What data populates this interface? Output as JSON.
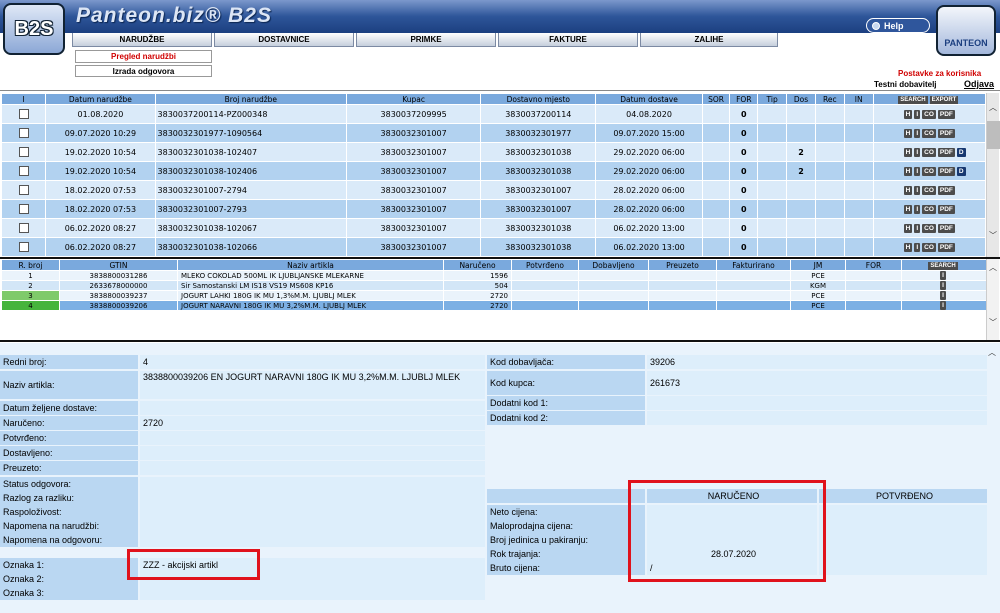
{
  "header": {
    "logo_text": "B2S",
    "brand": "Panteon.biz® B2S",
    "help": "Help",
    "right_logo_text": "PANTEON",
    "tabs": [
      "NARUDŽBE",
      "DOSTAVNICE",
      "PRIMKE",
      "FAKTURE",
      "ZALIHE"
    ],
    "sub_active": "Pregled narudžbi",
    "sub_other": "Izrada odgovora",
    "postavke": "Postavke za korisnika",
    "user": "Testni dobavitelj",
    "logout": "Odjava"
  },
  "orders": {
    "columns": [
      "I",
      "Datum narudžbe",
      "Broj narudžbe",
      "Kupac",
      "Dostavno mjesto",
      "Datum dostave",
      "SOR",
      "FOR",
      "Tip",
      "Dos",
      "Rec",
      "IN"
    ],
    "search": "SEARCH",
    "export": "EXPORT",
    "rows": [
      {
        "date": "01.08.2020",
        "num": "3830037200114-PZ000348",
        "kupac": "3830037209995",
        "mjesto": "3830037200114",
        "dostava": "04.08.2020",
        "for": "0",
        "dos": "",
        "btns": [
          "H",
          "I",
          "CO",
          "PDF"
        ]
      },
      {
        "date": "09.07.2020 10:29",
        "num": "3830032301977-1090564",
        "kupac": "3830032301007",
        "mjesto": "3830032301977",
        "dostava": "09.07.2020 15:00",
        "for": "0",
        "dos": "",
        "btns": [
          "H",
          "I",
          "CO",
          "PDF"
        ]
      },
      {
        "date": "19.02.2020 10:54",
        "num": "3830032301038-102407",
        "kupac": "3830032301007",
        "mjesto": "3830032301038",
        "dostava": "29.02.2020 06:00",
        "for": "0",
        "dos": "2",
        "btns": [
          "H",
          "I",
          "CO",
          "PDF",
          "D"
        ]
      },
      {
        "date": "19.02.2020 10:54",
        "num": "3830032301038-102406",
        "kupac": "3830032301007",
        "mjesto": "3830032301038",
        "dostava": "29.02.2020 06:00",
        "for": "0",
        "dos": "2",
        "btns": [
          "H",
          "I",
          "CO",
          "PDF",
          "D"
        ]
      },
      {
        "date": "18.02.2020 07:53",
        "num": "3830032301007-2794",
        "kupac": "3830032301007",
        "mjesto": "3830032301007",
        "dostava": "28.02.2020 06:00",
        "for": "0",
        "dos": "",
        "btns": [
          "H",
          "I",
          "CO",
          "PDF"
        ]
      },
      {
        "date": "18.02.2020 07:53",
        "num": "3830032301007-2793",
        "kupac": "3830032301007",
        "mjesto": "3830032301007",
        "dostava": "28.02.2020 06:00",
        "for": "0",
        "dos": "",
        "btns": [
          "H",
          "I",
          "CO",
          "PDF"
        ]
      },
      {
        "date": "06.02.2020 08:27",
        "num": "3830032301038-102067",
        "kupac": "3830032301007",
        "mjesto": "3830032301038",
        "dostava": "06.02.2020 13:00",
        "for": "0",
        "dos": "",
        "btns": [
          "H",
          "I",
          "CO",
          "PDF"
        ]
      },
      {
        "date": "06.02.2020 08:27",
        "num": "3830032301038-102066",
        "kupac": "3830032301007",
        "mjesto": "3830032301038",
        "dostava": "06.02.2020 13:00",
        "for": "0",
        "dos": "",
        "btns": [
          "H",
          "I",
          "CO",
          "PDF"
        ]
      }
    ]
  },
  "items": {
    "columns": [
      "R. broj",
      "GTIN",
      "Naziv artikla",
      "Naručeno",
      "Potvrđeno",
      "Dobavljeno",
      "Preuzeto",
      "Fakturirano",
      "JM",
      "FOR"
    ],
    "search": "SEARCH",
    "rows": [
      {
        "rb": "1",
        "gtin": "3838800031286",
        "naziv": "MLEKO COKOLAD 500ML IK LJUBLJANSKE MLEKARNE",
        "nar": "1596",
        "jm": "PCE"
      },
      {
        "rb": "2",
        "gtin": "2633678000000",
        "naziv": "Sir Samostanski LM IS18 VS19 MS608 KP16",
        "nar": "504",
        "jm": "KGM"
      },
      {
        "rb": "3",
        "gtin": "3838800039237",
        "naziv": "JOGURT LAHKI 180G IK MU 1,3%M.M. LJUBLJ MLEK",
        "nar": "2720",
        "jm": "PCE"
      },
      {
        "rb": "4",
        "gtin": "3838800039206",
        "naziv": "JOGURT NARAVNI 180G IK MU 3,2%M.M. LJUBLJ MLEK",
        "nar": "2720",
        "jm": "PCE"
      }
    ]
  },
  "detail": {
    "redni_broj_label": "Redni broj:",
    "redni_broj": "4",
    "naziv_label": "Naziv artikla:",
    "naziv": "3838800039206 EN JOGURT NARAVNI 180G IK MU 3,2%M.M. LJUBLJ MLEK",
    "datum_zeljene_label": "Datum željene dostave:",
    "naruceno_label": "Naručeno:",
    "naruceno": "2720",
    "potvrdeno_label": "Potvrđeno:",
    "dostavljeno_label": "Dostavljeno:",
    "preuzeto_label": "Preuzeto:",
    "kod_dobavljaca_label": "Kod dobavljača:",
    "kod_dobavljaca": "39206",
    "kod_kupca_label": "Kod kupca:",
    "kod_kupca": "261673",
    "dodatni1_label": "Dodatni kod 1:",
    "dodatni2_label": "Dodatni kod 2:",
    "status_label": "Status odgovora:",
    "razlog_label": "Razlog za razliku:",
    "raspolozivost_label": "Raspoloživost:",
    "napomena_nar_label": "Napomena na narudžbi:",
    "napomena_odg_label": "Napomena na odgovoru:",
    "oznaka1_label": "Oznaka 1:",
    "oznaka1": "ZZZ - akcijski artikl",
    "oznaka2_label": "Oznaka 2:",
    "oznaka3_label": "Oznaka 3:",
    "col_naruceno": "NARUČENO",
    "col_potvrdeno": "POTVRĐENO",
    "neto_label": "Neto cijena:",
    "maloprodajna_label": "Maloprodajna cijena:",
    "broj_jedinica_label": "Broj jedinica u pakiranju:",
    "rok_label": "Rok trajanja:",
    "rok": "28.07.2020",
    "bruto_label": "Bruto cijena:",
    "bruto": "/"
  }
}
